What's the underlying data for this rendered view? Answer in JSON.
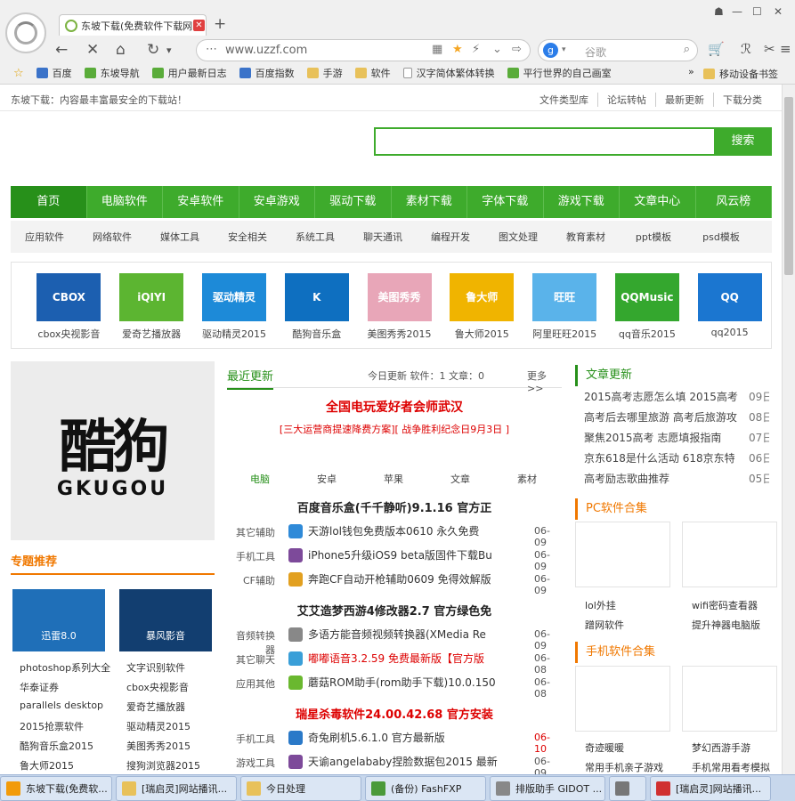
{
  "browser": {
    "tab_title": "东坡下载(免费软件下载网",
    "close_glyph": "✕",
    "newtab_glyph": "+",
    "window_buttons": [
      "☗",
      "—",
      "☐",
      "✕"
    ],
    "nav_icons": [
      "back-icon",
      "stop-icon",
      "home-icon",
      "refresh-icon",
      "dropdown-icon"
    ],
    "nav_glyphs": [
      "←",
      "✕",
      "⌂",
      "↻",
      "▾"
    ],
    "url": "www.uzzf.com",
    "url_icons": [
      "qr-icon",
      "star-icon",
      "lightning-icon",
      "chevron-down-icon",
      "forward-icon"
    ],
    "url_glyphs": [
      "▦",
      "★",
      "⚡",
      "⌄",
      "⇨"
    ],
    "search_engine": "g",
    "search_placeholder": "谷歌",
    "search_glyph": "⌕",
    "right_icons": [
      "cart-icon",
      "extension-icon",
      "tools-icon",
      "menu-icon"
    ],
    "right_glyphs": [
      "🛒",
      "ℛ",
      "✂",
      "≡"
    ],
    "bookmarks_star": "☆",
    "bookmarks": [
      {
        "label": "百度",
        "kind": "site"
      },
      {
        "label": "东坡导航",
        "kind": "green"
      },
      {
        "label": "用户最新日志",
        "kind": "green"
      },
      {
        "label": "百度指数",
        "kind": "site"
      },
      {
        "label": "手游",
        "kind": "folder"
      },
      {
        "label": "软件",
        "kind": "folder"
      },
      {
        "label": "汉字简体繁体转换",
        "kind": "file"
      },
      {
        "label": "平行世界的自己画室",
        "kind": "green"
      }
    ],
    "bookmarks_more": "»",
    "bookmarks_mobile": "移动设备书签"
  },
  "page": {
    "tagline": "东坡下载：内容最丰富最安全的下载站！",
    "toplinks": [
      "文件类型库",
      "论坛转帖",
      "最新更新",
      "下载分类"
    ],
    "search_button": "搜索",
    "main_nav": [
      "首页",
      "电脑软件",
      "安卓软件",
      "安卓游戏",
      "驱动下载",
      "素材下载",
      "字体下载",
      "游戏下载",
      "文章中心",
      "风云榜"
    ],
    "sub_nav": [
      "应用软件",
      "网络软件",
      "媒体工具",
      "安全相关",
      "系统工具",
      "聊天通讯",
      "编程开发",
      "图文处理",
      "教育素材",
      "ppt模板",
      "psd模板"
    ],
    "apps": [
      {
        "name": "cbox央视影音",
        "color": "#1c5fb0",
        "text": "CBOX"
      },
      {
        "name": "爱奇艺播放器",
        "color": "#5cb531",
        "text": "iQIYI"
      },
      {
        "name": "驱动精灵2015",
        "color": "#1d8ad8",
        "text": "驱动精灵"
      },
      {
        "name": "酷狗音乐盒",
        "color": "#0e6fc0",
        "text": "K"
      },
      {
        "name": "美图秀秀2015",
        "color": "#e8a6b8",
        "text": "美图秀秀"
      },
      {
        "name": "鲁大师2015",
        "color": "#f0b400",
        "text": "鲁大师"
      },
      {
        "name": "阿里旺旺2015",
        "color": "#5ab3ea",
        "text": "旺旺"
      },
      {
        "name": "qq音乐2015",
        "color": "#34a72e",
        "text": "QQMusic"
      },
      {
        "name": "qq2015",
        "color": "#1b76d0",
        "text": "QQ"
      }
    ]
  },
  "left": {
    "banner_big": "酷狗",
    "banner_small": "GKUGOU",
    "section_title": "专题推荐",
    "promo1": "迅雷8.0",
    "promo2": "暴风影音",
    "links": [
      "photoshop系列大全",
      "文字识别软件",
      "华泰证券",
      "cbox央视影音",
      "parallels desktop",
      "爱奇艺播放器",
      "2015抢票软件",
      "驱动精灵2015",
      "酷狗音乐盒2015",
      "美图秀秀2015",
      "鲁大师2015",
      "搜狗浏览器2015"
    ]
  },
  "middle": {
    "title": "最近更新",
    "counts": "今日更新 软件：1 文章：0",
    "more": "更多>>",
    "headline": "全国电玩爱好者会师武汉",
    "subhead": "[三大运营商提速降费方案][ 战争胜利纪念日9月3日 ]",
    "tabs": [
      "电脑",
      "安卓",
      "苹果",
      "文章",
      "素材"
    ],
    "sections": [
      {
        "title": "百度音乐盒(千千静听)9.1.16 官方正",
        "rows": [
          {
            "cat": "其它辅助",
            "title": "天游lol钱包免费版本0610 永久免费",
            "date": "06-09",
            "color": "#2f8ad8",
            "red": false
          },
          {
            "cat": "手机工具",
            "title": "iPhone5升级iOS9 beta版固件下载Bu",
            "date": "06-09",
            "color": "#7d4a9a",
            "red": false
          },
          {
            "cat": "CF辅助",
            "title": "奔跑CF自动开枪辅助0609 免得效解版",
            "date": "06-09",
            "color": "#e2a020",
            "red": false
          }
        ]
      },
      {
        "title": "艾艾造梦西游4修改器2.7 官方绿色免",
        "rows": [
          {
            "cat": "音频转换器",
            "title": "多语方能音频视频转换器(XMedia Re",
            "date": "06-09",
            "color": "#888888",
            "red": false
          },
          {
            "cat": "其它聊天",
            "title": "嘟嘟语音3.2.59 免费最新版【官方版",
            "date": "06-08",
            "color": "#3a9fd8",
            "red": true
          },
          {
            "cat": "应用其他",
            "title": "蘑菇ROM助手(rom助手下载)10.0.150",
            "date": "06-08",
            "color": "#6ab82f",
            "red": false
          }
        ]
      },
      {
        "title": "瑞星杀毒软件24.00.42.68 官方安装",
        "red": true,
        "rows": [
          {
            "cat": "手机工具",
            "title": "奇兔刷机5.6.1.0 官方最新版",
            "date": "06-10",
            "color": "#2a79c8",
            "red": false,
            "dred": true
          },
          {
            "cat": "游戏工具",
            "title": "天谕angelababy捏脸数据包2015 最新",
            "date": "06-09",
            "color": "#7d4a9a",
            "red": false
          }
        ]
      }
    ]
  },
  "right": {
    "news_title": "文章更新",
    "news": [
      {
        "title": "2015高考志愿怎么填 2015高考",
        "date": "09日"
      },
      {
        "title": "高考后去哪里旅游 高考后旅游攻",
        "date": "08日"
      },
      {
        "title": "聚焦2015高考 志愿填报指南",
        "date": "07日"
      },
      {
        "title": "京东618是什么活动 618京东特",
        "date": "06日"
      },
      {
        "title": "高考励志歌曲推荐",
        "date": "05日"
      }
    ],
    "pc_title": "PC软件合集",
    "pc_items": [
      "lol外挂",
      "wifi密码查看器",
      "蹭网软件",
      "提升神器电脑版"
    ],
    "mobile_title": "手机软件合集",
    "mobile_items": [
      "奇迹暖暖",
      "梦幻西游手游",
      "常用手机亲子游戏",
      "手机常用看考模拟"
    ]
  },
  "taskbar": [
    {
      "label": "东坡下载(免费软...",
      "color": "#f29b0a",
      "w": 126
    },
    {
      "label": "[瑞启灵]网站播讯...",
      "color": "#e8c15a",
      "w": 136
    },
    {
      "label": "今日处理",
      "color": "#e8c15a",
      "w": 136
    },
    {
      "label": "(备份) FashFXP",
      "color": "#4a9a3a",
      "w": 136
    },
    {
      "label": "排版助手 GIDOT ...",
      "color": "#888888",
      "w": 130
    },
    {
      "label": "",
      "color": "#777777",
      "w": 42
    },
    {
      "label": "[瑞启灵]网站播讯...",
      "color": "#d03030",
      "w": 136
    }
  ]
}
